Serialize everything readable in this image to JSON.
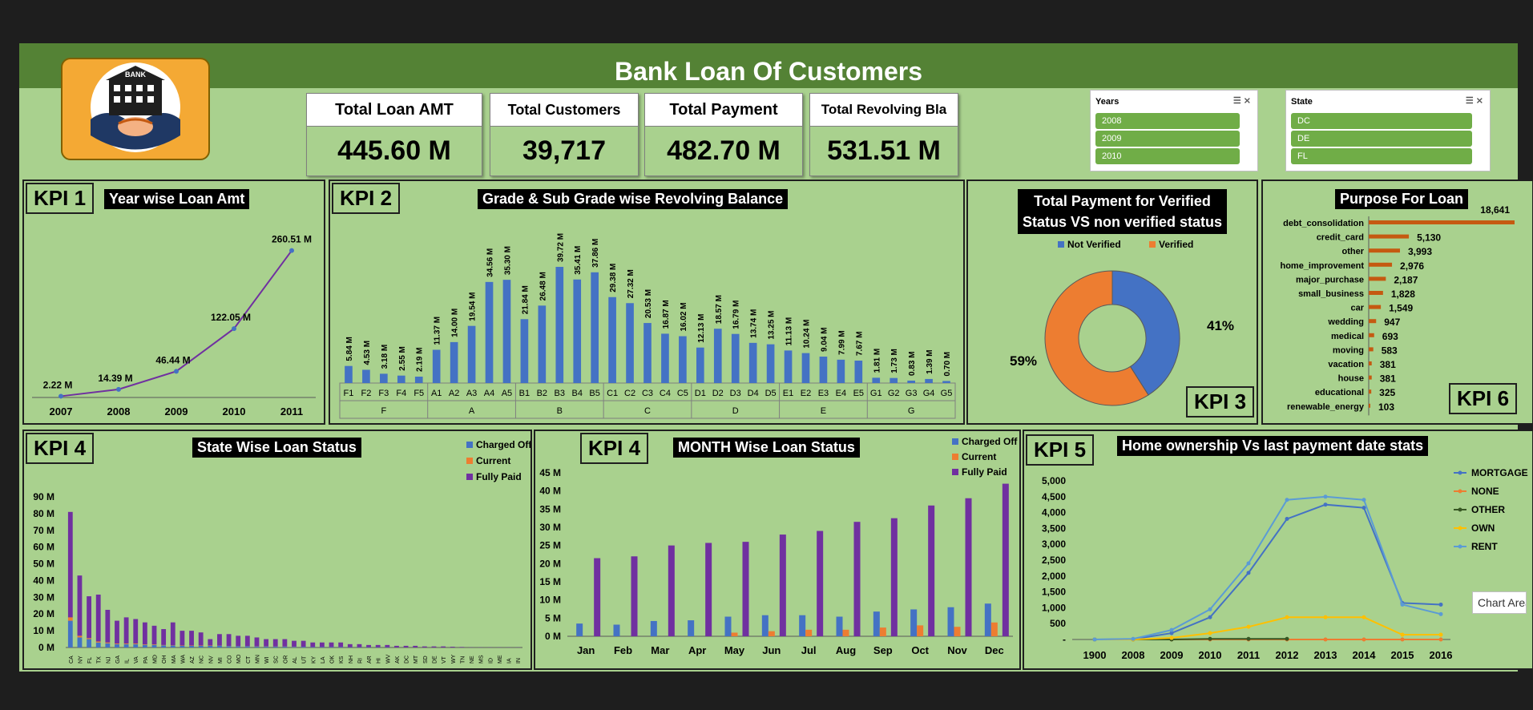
{
  "title": "Bank Loan Of Customers",
  "logo_text": "BANK",
  "colors": {
    "background": "#a9d18e",
    "header": "#548235",
    "blue": "#4472c4",
    "orange": "#ed7d31",
    "purple": "#7030a0",
    "line_purple": "#7030a0",
    "yellow": "#ffc000",
    "gray": "#a5a5a5",
    "green": "#70ad47"
  },
  "cards": [
    {
      "label": "Total Loan AMT",
      "value": "445.60 M"
    },
    {
      "label": "Total Customers",
      "value": "39,717"
    },
    {
      "label": "Total Payment",
      "value": "482.70 M"
    },
    {
      "label": "Total Revolving Bla",
      "value": "531.51 M"
    }
  ],
  "slicers": {
    "years": {
      "title": "Years",
      "items": [
        "2008",
        "2009",
        "2010"
      ]
    },
    "state": {
      "title": "State",
      "items": [
        "DC",
        "DE",
        "FL"
      ]
    }
  },
  "kpi_labels": {
    "kpi1": "KPI 1",
    "kpi2": "KPI 2",
    "kpi3": "KPI 3",
    "kpi4a": "KPI 4",
    "kpi4b": "KPI 4",
    "kpi5": "KPI 5",
    "kpi6": "KPI 6"
  },
  "tooltip": "Chart Area",
  "chart_data": [
    {
      "id": "kpi1",
      "type": "line",
      "title": "Year wise Loan Amt",
      "categories": [
        "2007",
        "2008",
        "2009",
        "2010",
        "2011"
      ],
      "values": [
        2.22,
        14.39,
        46.44,
        122.05,
        260.51
      ],
      "labels": [
        "2.22 M",
        "14.39 M",
        "46.44 M",
        "122.05 M",
        "260.51 M"
      ]
    },
    {
      "id": "kpi2",
      "type": "bar",
      "title": "Grade & Sub Grade wise Revolving Balance",
      "groups": [
        {
          "name": "F",
          "categories": [
            "F1",
            "F2",
            "F3",
            "F4",
            "F5"
          ],
          "values": [
            5.84,
            4.53,
            3.18,
            2.55,
            2.19
          ]
        },
        {
          "name": "A",
          "categories": [
            "A1",
            "A2",
            "A3",
            "A4",
            "A5"
          ],
          "values": [
            11.37,
            14.0,
            19.54,
            34.56,
            35.3
          ]
        },
        {
          "name": "B",
          "categories": [
            "B1",
            "B2",
            "B3",
            "B4",
            "B5"
          ],
          "values": [
            21.84,
            26.48,
            39.72,
            35.41,
            37.86
          ]
        },
        {
          "name": "C",
          "categories": [
            "C1",
            "C2",
            "C3",
            "C4",
            "C5"
          ],
          "values": [
            29.38,
            27.32,
            20.53,
            16.87,
            16.02
          ]
        },
        {
          "name": "D",
          "categories": [
            "D1",
            "D2",
            "D3",
            "D4",
            "D5"
          ],
          "values": [
            12.13,
            18.57,
            16.79,
            13.74,
            13.25
          ]
        },
        {
          "name": "E",
          "categories": [
            "E1",
            "E2",
            "E3",
            "E4",
            "E5"
          ],
          "values": [
            11.13,
            10.24,
            9.04,
            7.99,
            7.67
          ]
        },
        {
          "name": "G",
          "categories": [
            "G1",
            "G2",
            "G3",
            "G4",
            "G5"
          ],
          "values": [
            1.81,
            1.73,
            0.83,
            1.39,
            0.7
          ]
        }
      ],
      "labels": {
        "F": [
          "5.84 M",
          "4.53 M",
          "3.18 M",
          "2.55 M",
          "2.19 M"
        ],
        "A": [
          "11.37 M",
          "14.00 M",
          "19.54 M",
          "34.56 M",
          "35.30 M"
        ],
        "B": [
          "21.84 M",
          "26.48 M",
          "39.72 M",
          "35.41 M",
          "37.86 M"
        ],
        "C": [
          "29.38 M",
          "27.32 M",
          "20.53 M",
          "16.87 M",
          "16.02 M"
        ],
        "D": [
          "12.13 M",
          "18.57 M",
          "16.79 M",
          "13.74 M",
          "13.25 M"
        ],
        "E": [
          "11.13 M",
          "10.24 M",
          "9.04 M",
          "7.99 M",
          "7.67 M"
        ],
        "G": [
          "1.81 M",
          "1.73 M",
          "0.83 M",
          "1.39 M",
          "0.70 M"
        ]
      }
    },
    {
      "id": "kpi3",
      "type": "pie",
      "title": "Total Payment for Verified Status VS non verified status",
      "title_lines": [
        "Total Payment for Verified",
        "Status VS non verified status"
      ],
      "series": [
        {
          "name": "Not Verified",
          "value": 41,
          "label": "41%"
        },
        {
          "name": "Verified",
          "value": 59,
          "label": "59%"
        }
      ],
      "legend": "top"
    },
    {
      "id": "kpi6",
      "type": "bar",
      "title": "Purpose For Loan",
      "orientation": "horizontal",
      "categories": [
        "debt_consolidation",
        "credit_card",
        "other",
        "home_improvement",
        "major_purchase",
        "small_business",
        "car",
        "wedding",
        "medical",
        "moving",
        "vacation",
        "house",
        "educational",
        "renewable_energy"
      ],
      "values": [
        18641,
        5130,
        3993,
        2976,
        2187,
        1828,
        1549,
        947,
        693,
        583,
        381,
        381,
        325,
        103
      ],
      "labels": [
        "18,641",
        "5,130",
        "3,993",
        "2,976",
        "2,187",
        "1,828",
        "1,549",
        "947",
        "693",
        "583",
        "381",
        "381",
        "325",
        "103"
      ]
    },
    {
      "id": "kpi4a",
      "type": "bar",
      "title": "State Wise Loan Status",
      "stacked": true,
      "categories": [
        "CA",
        "NY",
        "FL",
        "TX",
        "NJ",
        "GA",
        "IL",
        "VA",
        "PA",
        "MD",
        "OH",
        "MA",
        "WA",
        "AZ",
        "NC",
        "NV",
        "MI",
        "CO",
        "MO",
        "CT",
        "MN",
        "WI",
        "SC",
        "OR",
        "AL",
        "UT",
        "KY",
        "LA",
        "OK",
        "KS",
        "NH",
        "RI",
        "AR",
        "HI",
        "WV",
        "AK",
        "DC",
        "MT",
        "SD",
        "DE",
        "VT",
        "WY",
        "TN",
        "NE",
        "MS",
        "ID",
        "ME",
        "IA",
        "IN"
      ],
      "series": [
        {
          "name": "Charged Off",
          "values": [
            16,
            6,
            5,
            3,
            2.5,
            2,
            2,
            2,
            1.6,
            1.6,
            1.3,
            1.2,
            1,
            1,
            1,
            1,
            1,
            0.8,
            0.7,
            0.7,
            0.6,
            0.6,
            0.5,
            0.5,
            0.4,
            0.4,
            0.3,
            0.3,
            0.3,
            0.3,
            0.2,
            0.2,
            0.2,
            0.2,
            0.2,
            0.1,
            0.1,
            0.1,
            0.05,
            0.05,
            0.05,
            0.05,
            0.01,
            0.01,
            0.01,
            0.01,
            0.01,
            0.01,
            0.01
          ]
        },
        {
          "name": "Current",
          "values": [
            2,
            1,
            0.6,
            0.6,
            0.5,
            0.4,
            0.4,
            0.4,
            0.3,
            0.3,
            0.2,
            0.2,
            0.2,
            0.2,
            0.2,
            0.2,
            0.1,
            0.1,
            0.1,
            0.1,
            0.1,
            0.1,
            0.1,
            0.1,
            0.1,
            0,
            0,
            0,
            0,
            0,
            0,
            0,
            0,
            0,
            0,
            0,
            0,
            0,
            0,
            0,
            0,
            0,
            0,
            0,
            0,
            0,
            0,
            0,
            0
          ]
        },
        {
          "name": "Fully Paid",
          "values": [
            63,
            36,
            25,
            28,
            19.5,
            13.6,
            15.6,
            14.6,
            13.1,
            11.1,
            9.5,
            13.6,
            8.8,
            8.8,
            7.8,
            3.8,
            6.9,
            7.1,
            6.2,
            6.2,
            5.3,
            4.3,
            4.4,
            4.4,
            3.5,
            3.6,
            2.7,
            2.7,
            2.7,
            2.7,
            1.8,
            1.8,
            1.3,
            1.3,
            1.3,
            0.9,
            0.9,
            0.9,
            0.6,
            0.6,
            0.6,
            0.4,
            0.3,
            0.1,
            0.1,
            0.1,
            0.1,
            0.1,
            0.1
          ]
        }
      ],
      "y_ticks": [
        "0 M",
        "10 M",
        "20 M",
        "30 M",
        "40 M",
        "50 M",
        "60 M",
        "70 M",
        "80 M",
        "90 M"
      ],
      "ylim": [
        0,
        90
      ]
    },
    {
      "id": "kpi4b",
      "type": "bar",
      "title": "MONTH Wise Loan Status",
      "categories": [
        "Jan",
        "Feb",
        "Mar",
        "Apr",
        "May",
        "Jun",
        "Jul",
        "Aug",
        "Sep",
        "Oct",
        "Nov",
        "Dec"
      ],
      "series": [
        {
          "name": "Charged Off",
          "values": [
            3.5,
            3.2,
            4.2,
            4.4,
            5.4,
            5.8,
            5.8,
            5.4,
            6.8,
            7.4,
            8,
            9
          ]
        },
        {
          "name": "Current",
          "values": [
            0,
            0,
            0,
            0,
            1,
            1.4,
            1.8,
            1.8,
            2.4,
            3,
            2.6,
            3.8
          ]
        },
        {
          "name": "Fully Paid",
          "values": [
            21.5,
            22,
            25,
            25.7,
            26,
            28,
            29,
            31.5,
            32.5,
            36,
            38,
            42
          ]
        }
      ],
      "y_ticks": [
        "0 M",
        "5 M",
        "10 M",
        "15 M",
        "20 M",
        "25 M",
        "30 M",
        "35 M",
        "40 M",
        "45 M"
      ],
      "ylim": [
        0,
        45
      ]
    },
    {
      "id": "kpi5",
      "type": "line",
      "title": "Home ownership Vs last payment date stats",
      "categories": [
        "1900",
        "2008",
        "2009",
        "2010",
        "2011",
        "2012",
        "2013",
        "2014",
        "2015",
        "2016"
      ],
      "series": [
        {
          "name": "MORTGAGE",
          "values": [
            0,
            10,
            200,
            700,
            2100,
            3800,
            4250,
            4150,
            1150,
            1100
          ]
        },
        {
          "name": "NONE",
          "values": [
            0,
            0,
            0,
            0,
            0,
            0,
            0,
            0,
            0,
            0
          ]
        },
        {
          "name": "OTHER",
          "values": [
            0,
            0,
            0,
            20,
            20,
            20,
            null,
            null,
            null,
            null
          ]
        },
        {
          "name": "OWN",
          "values": [
            0,
            0,
            50,
            200,
            400,
            700,
            700,
            700,
            150,
            150
          ]
        },
        {
          "name": "RENT",
          "values": [
            0,
            20,
            300,
            950,
            2400,
            4400,
            4500,
            4400,
            1100,
            800
          ]
        }
      ],
      "y_ticks": [
        "-",
        "500",
        "1,000",
        "1,500",
        "2,000",
        "2,500",
        "3,000",
        "3,500",
        "4,000",
        "4,500",
        "5,000"
      ],
      "ylim": [
        0,
        5000
      ]
    }
  ]
}
